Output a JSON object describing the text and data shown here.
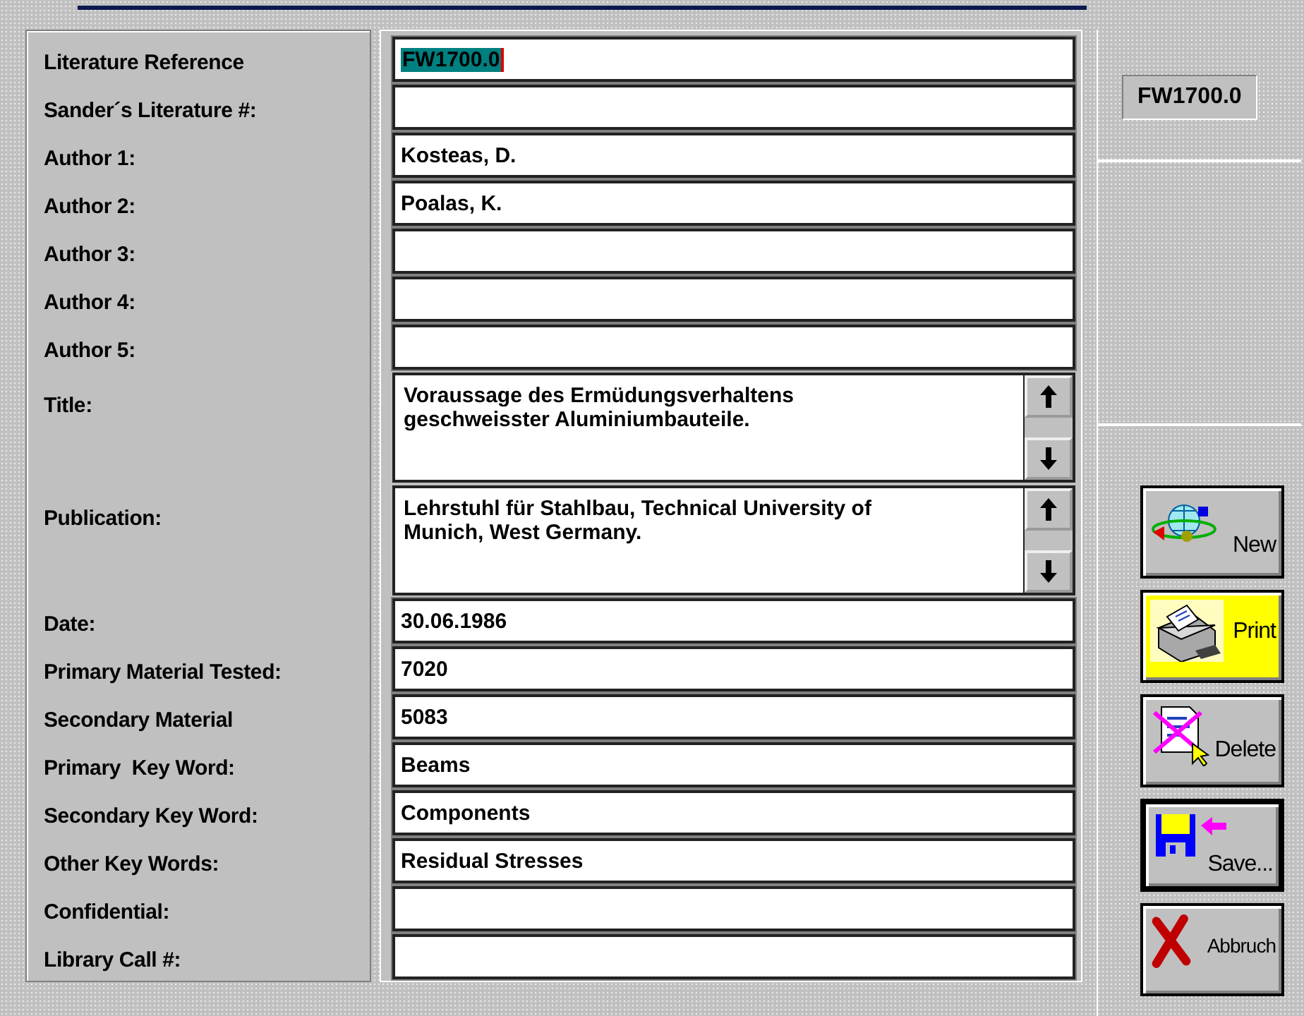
{
  "fields": [
    {
      "label": "Literature Reference",
      "kind": "text",
      "value": "FW1700.0",
      "highlighted": true
    },
    {
      "label": "Sander´s Literature #:",
      "kind": "text",
      "highlighted": false
    },
    {
      "label": "Author 1:",
      "kind": "text",
      "value": "Kosteas, D.",
      "highlighted": false
    },
    {
      "label": "Author 2:",
      "kind": "text",
      "value": "Poalas, K.",
      "highlighted": false
    },
    {
      "label": "Author 3:",
      "kind": "text",
      "highlighted": false
    },
    {
      "label": "Author 4:",
      "kind": "text",
      "highlighted": false
    },
    {
      "label": "Author 5:",
      "kind": "text",
      "highlighted": false
    },
    {
      "label": "Title:",
      "kind": "memo",
      "value": "Voraussage des Ermüdungsverhaltens geschweisster Aluminiumbauteile.",
      "highlighted": false
    },
    {
      "label": "Publication:",
      "kind": "memo",
      "value": "Lehrstuhl für Stahlbau, Technical University of Munich, West Germany.",
      "highlighted": false
    },
    {
      "label": "Date:",
      "kind": "text",
      "value": "30.06.1986",
      "highlighted": false
    },
    {
      "label": "Primary Material Tested:",
      "kind": "text",
      "value": "7020",
      "highlighted": false
    },
    {
      "label": "Secondary Material",
      "kind": "text",
      "value": "5083",
      "highlighted": false
    },
    {
      "label": "Primary  Key Word:",
      "kind": "text",
      "value": "Beams",
      "highlighted": false
    },
    {
      "label": "Secondary Key Word:",
      "kind": "text",
      "value": "Components",
      "highlighted": false
    },
    {
      "label": "Other Key Words:",
      "kind": "text",
      "value": "Residual Stresses",
      "highlighted": false
    },
    {
      "label": "Confidential:",
      "kind": "text",
      "highlighted": false
    },
    {
      "label": "Library Call #:",
      "kind": "text",
      "highlighted": false
    }
  ],
  "record_id": "FW1700.0",
  "buttons": [
    {
      "label": "New",
      "kind": "new",
      "highlighted": false,
      "default": false
    },
    {
      "label": "Print",
      "kind": "print",
      "highlighted": true,
      "default": false
    },
    {
      "label": "Delete",
      "kind": "delete",
      "highlighted": false,
      "default": false
    },
    {
      "label": "Save...",
      "kind": "save",
      "highlighted": false,
      "default": true
    },
    {
      "label": "Abbruch",
      "kind": "cancel",
      "highlighted": false,
      "default": false
    }
  ]
}
